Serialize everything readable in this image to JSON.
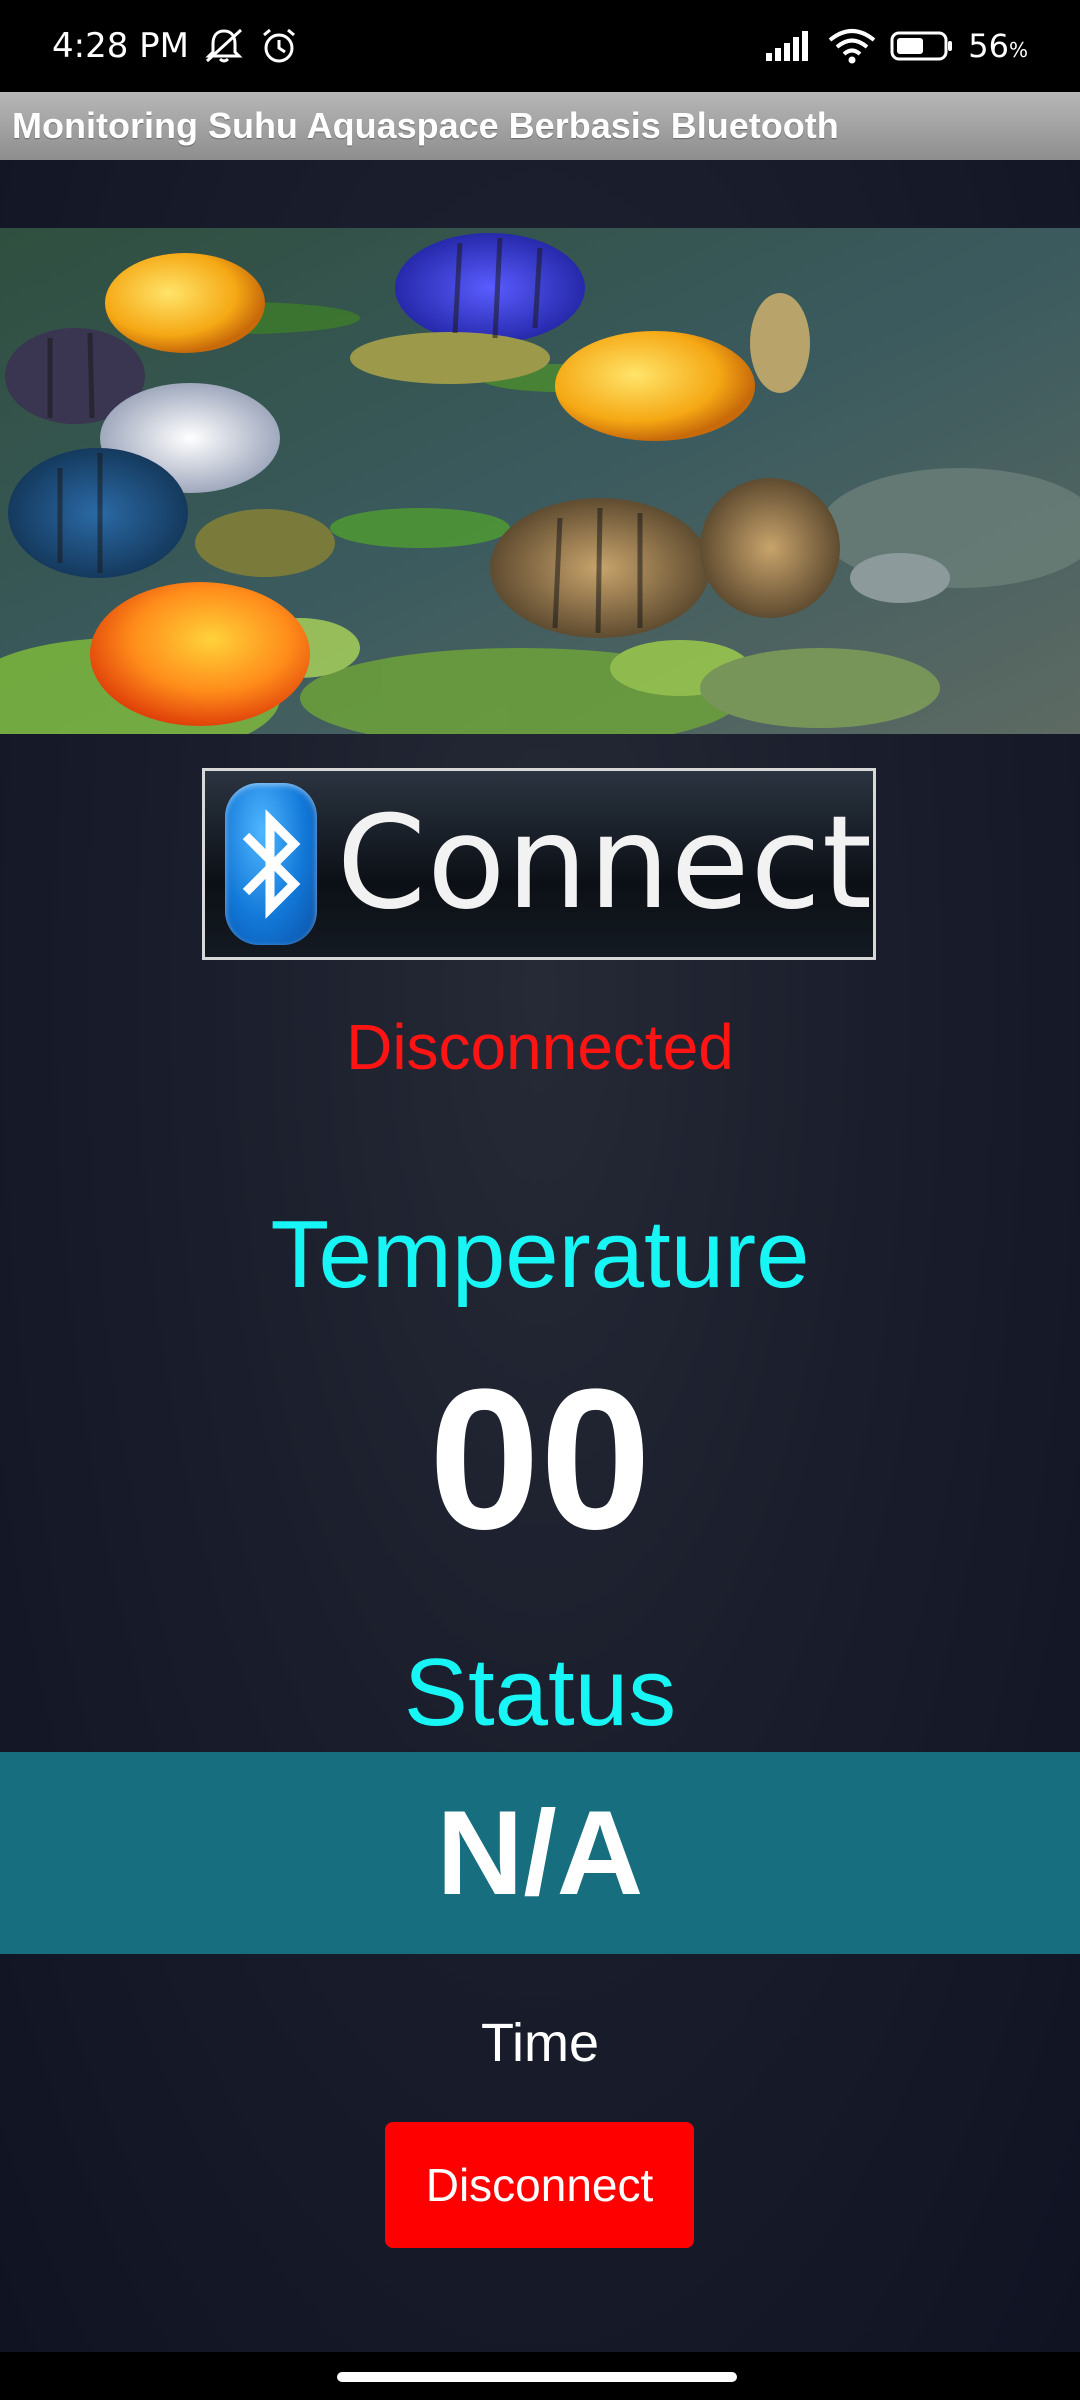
{
  "status_bar": {
    "time": "4:28 PM",
    "battery_percent": "56",
    "battery_unit": "%",
    "icons": [
      "mute-icon",
      "alarm-icon",
      "signal-icon",
      "wifi-icon",
      "battery-icon"
    ]
  },
  "app": {
    "title": "Monitoring Suhu Aquaspace Berbasis Bluetooth",
    "connect_button_label": "Connect",
    "connection_status": "Disconnected",
    "temperature_label": "Temperature",
    "temperature_value": "00",
    "status_label": "Status",
    "status_value": "N/A",
    "time_label": "Time",
    "disconnect_button_label": "Disconnect"
  },
  "colors": {
    "disconnected_text": "#ff1414",
    "label_cyan": "#18f5f5",
    "status_band": "#166e7e",
    "disconnect_button": "#ff0000"
  }
}
